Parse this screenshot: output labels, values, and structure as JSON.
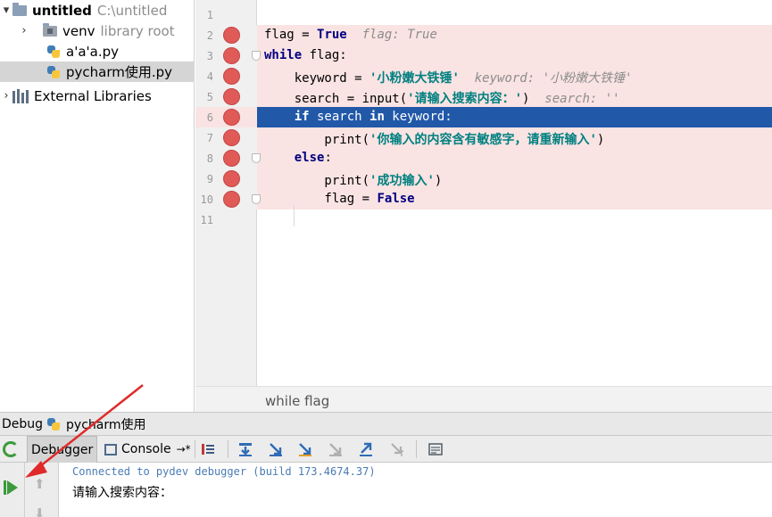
{
  "project_tree": {
    "root": {
      "name": "untitled",
      "path": "C:\\untitled"
    },
    "venv": {
      "name": "venv",
      "note": "library root"
    },
    "files": [
      "a'a'a.py",
      "pycharm使用.py"
    ],
    "external": "External Libraries"
  },
  "editor": {
    "line_numbers": [
      "1",
      "2",
      "3",
      "4",
      "5",
      "6",
      "7",
      "8",
      "9",
      "10",
      "11"
    ],
    "lines": {
      "l2": {
        "a": "flag = ",
        "b": "True",
        "hint": "  flag: True"
      },
      "l3": {
        "a": "while",
        "b": " flag:"
      },
      "l4": {
        "a": "    keyword = ",
        "b": "'小粉嫩大铁锤'",
        "hint": "  keyword: '小粉嫩大铁锤'"
      },
      "l5": {
        "a": "    search = input(",
        "b": "'请输入搜索内容：'",
        "c": ")",
        "hint": "  search: ''"
      },
      "l6": {
        "a": "    if",
        "b": " search ",
        "c": "in",
        "d": " keyword:"
      },
      "l7": {
        "a": "        print(",
        "b": "'你输入的内容含有敏感字，请重新输入'",
        "c": ")"
      },
      "l8": {
        "a": "    else",
        "b": ":"
      },
      "l9": {
        "a": "        print(",
        "b": "'成功输入'",
        "c": ")"
      },
      "l10": {
        "a": "        flag = ",
        "b": "False"
      }
    },
    "breadcrumb": "while flag"
  },
  "debug": {
    "title": "Debug",
    "config": "pycharm使用",
    "tabs": {
      "debugger": "Debugger",
      "console": "Console"
    },
    "console": {
      "line1": "Connected to pydev debugger (build 173.4674.37)",
      "line2": "请输入搜索内容："
    }
  },
  "colors": {
    "breakpoint": "#e05a57",
    "current_line": "#2158a8",
    "breakpoint_line": "#fae3e3",
    "annotation_arrow": "#e02a2a"
  }
}
